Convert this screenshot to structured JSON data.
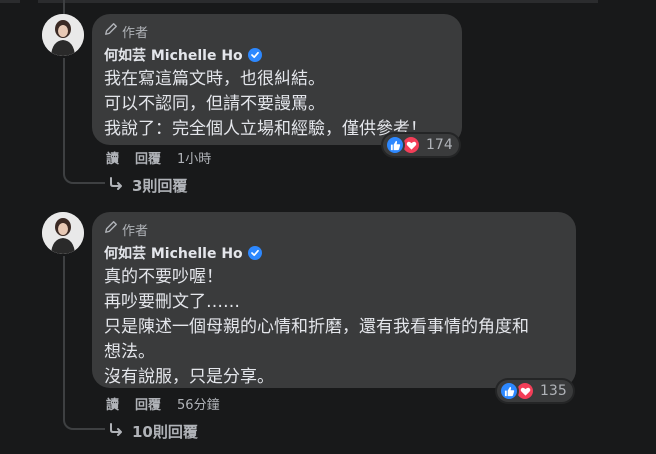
{
  "colors": {
    "background": "#18191a",
    "bubble": "#3a3b3c",
    "text_primary": "#e4e6eb",
    "text_secondary": "#b0b3b8",
    "like_blue": "#2d88ff",
    "love_red": "#f33e58"
  },
  "comments": [
    {
      "author_tag_icon": "pencil-icon",
      "author_tag": "作者",
      "author_name": "何如芸 Michelle Ho",
      "verified_icon": "verified-badge-icon",
      "lines": [
        "我在寫這篇文時，也很糾結。",
        "可以不認同，但請不要謾罵。",
        "我說了：完全個人立場和經驗，僅供參考！"
      ],
      "reaction_icons": [
        "like-icon",
        "love-icon"
      ],
      "reaction_count": "174",
      "action_read": "讀",
      "action_reply": "回覆",
      "timestamp": "1小時",
      "replies_label": "3則回覆"
    },
    {
      "author_tag_icon": "pencil-icon",
      "author_tag": "作者",
      "author_name": "何如芸 Michelle Ho",
      "verified_icon": "verified-badge-icon",
      "lines": [
        "真的不要吵喔！",
        "再吵要刪文了……",
        "只是陳述一個母親的心情和折磨，還有我看事情的角度和",
        "想法。",
        "沒有說服，只是分享。"
      ],
      "reaction_icons": [
        "like-icon",
        "love-icon"
      ],
      "reaction_count": "135",
      "action_read": "讀",
      "action_reply": "回覆",
      "timestamp": "56分鐘",
      "replies_label": "10則回覆"
    }
  ]
}
